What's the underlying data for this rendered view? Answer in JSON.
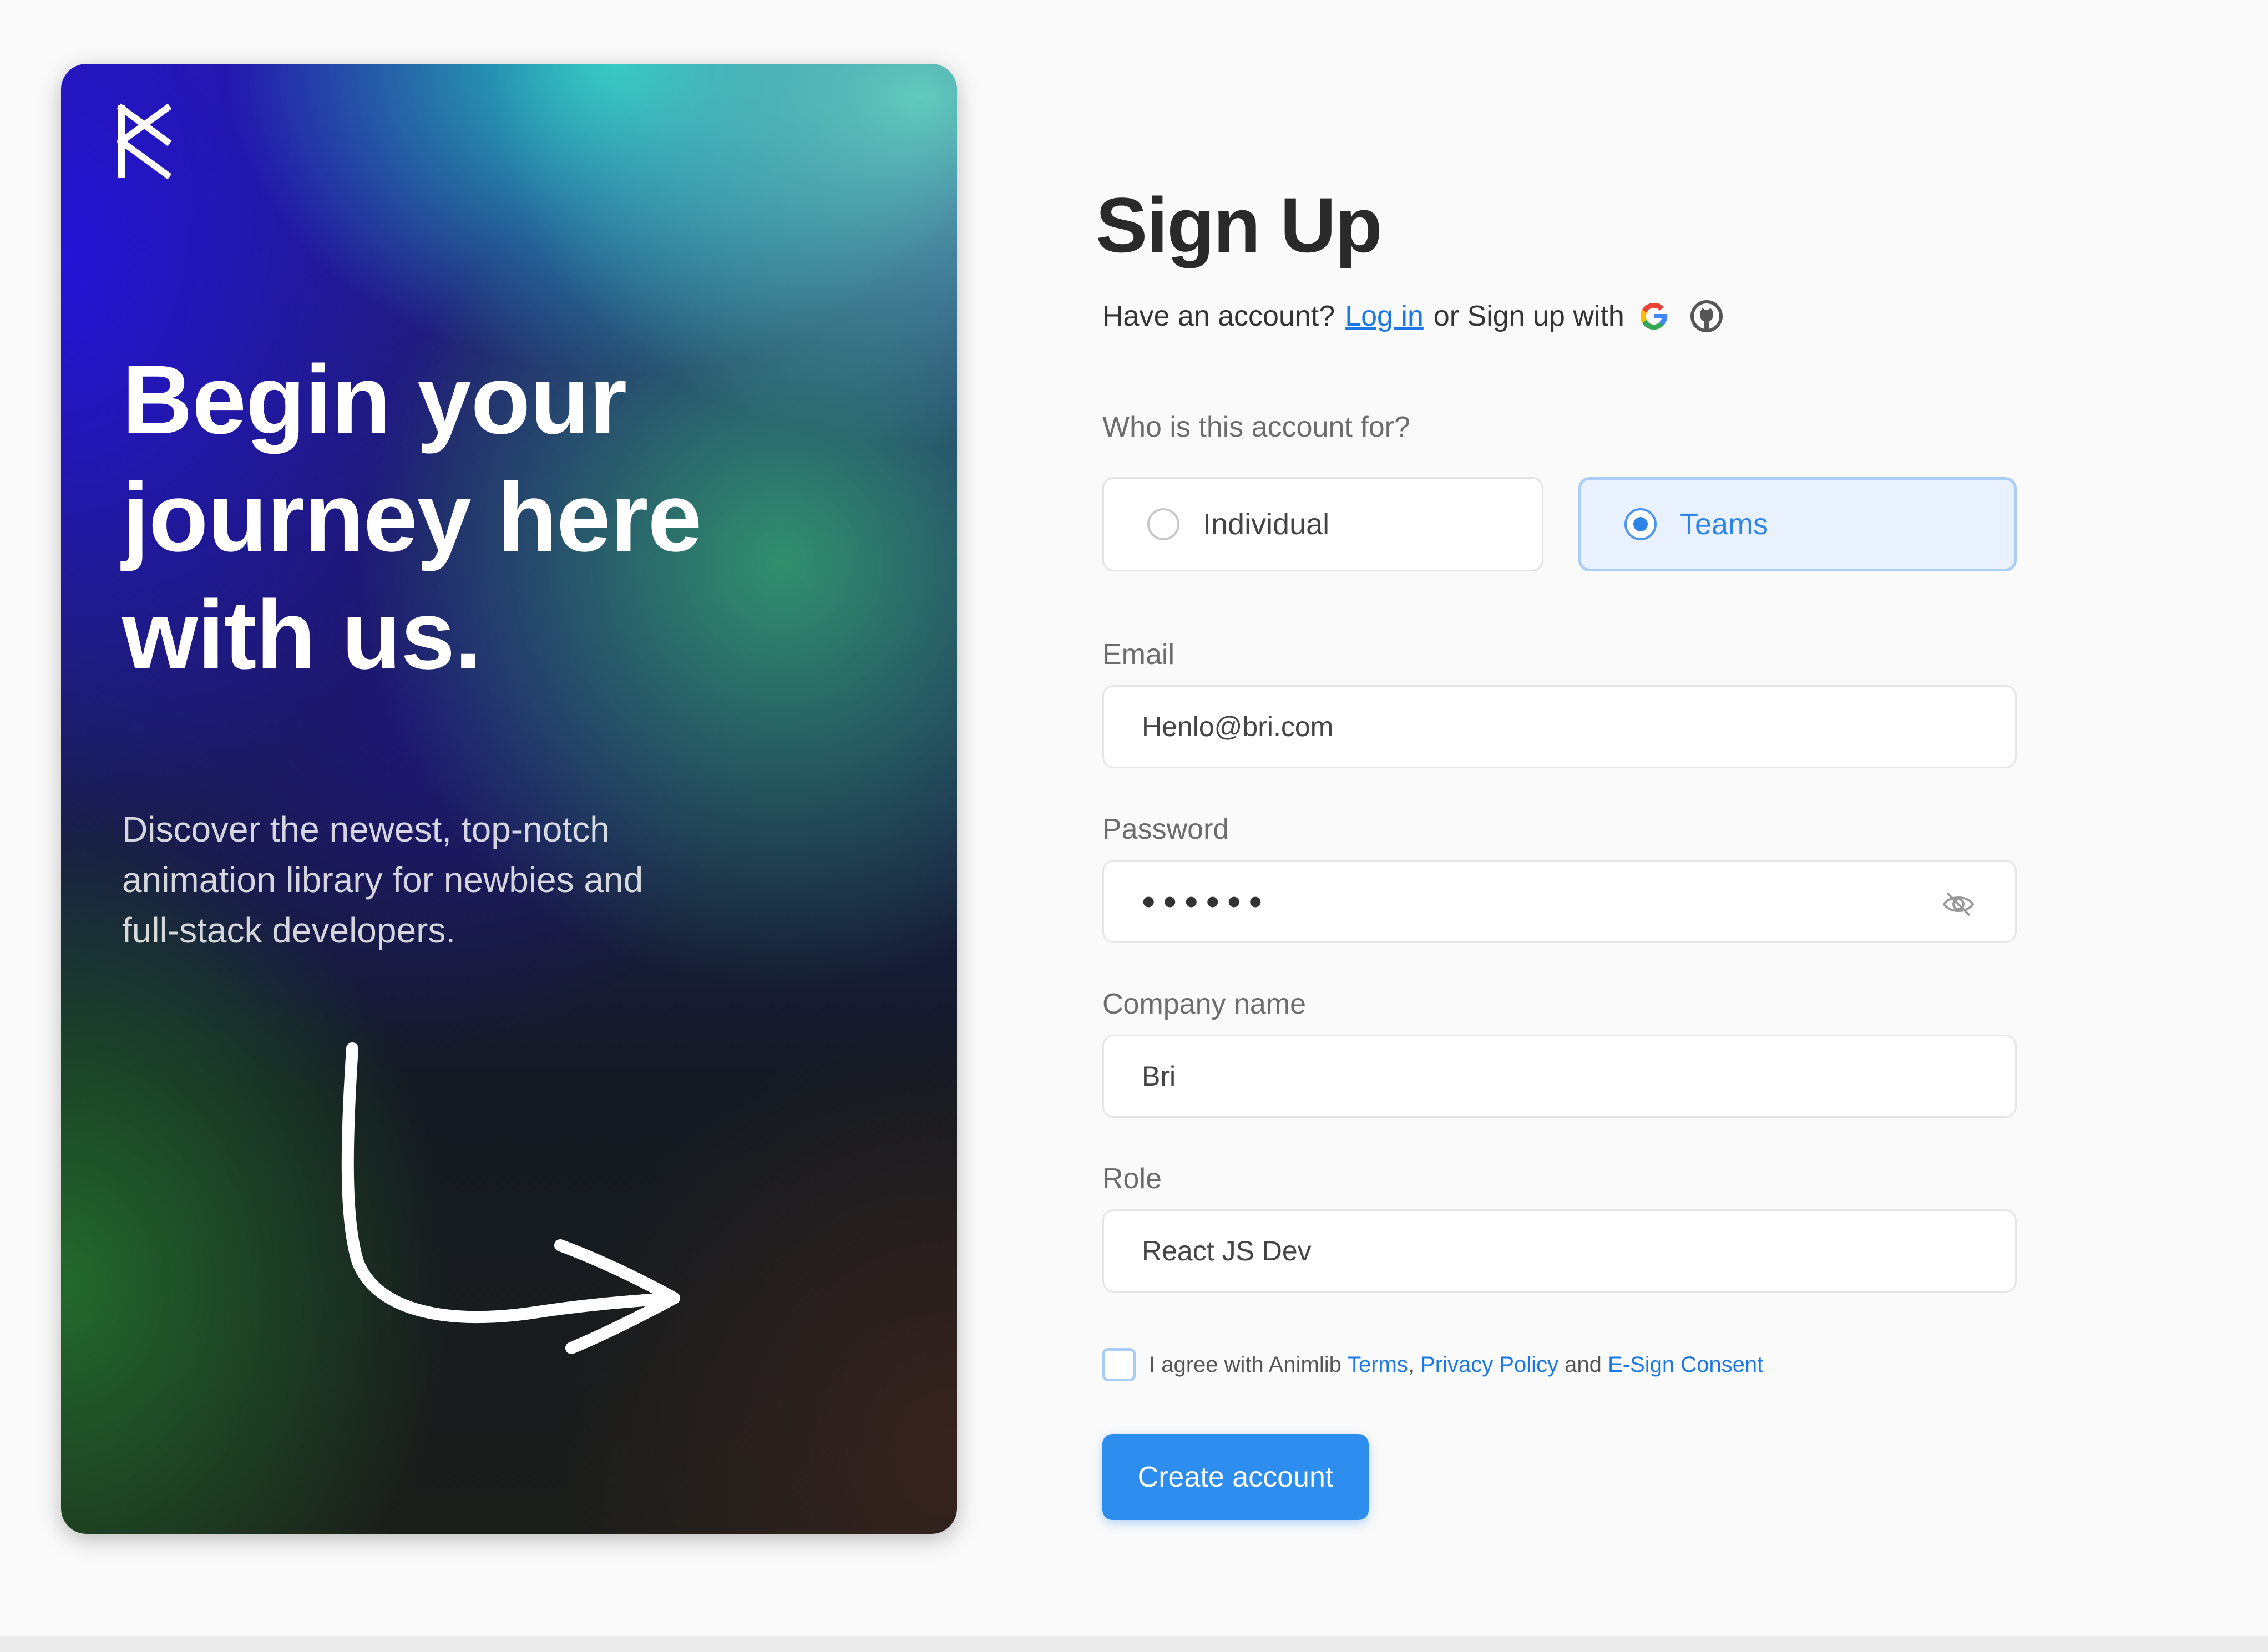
{
  "hero": {
    "logo_icon": "brand-logo-icon",
    "title_line1": "Begin your",
    "title_line2": "journey here",
    "title_line3": "with us.",
    "subtitle_line1": "Discover the newest, top-notch",
    "subtitle_line2": "animation library for newbies and",
    "subtitle_line3": "full-stack developers.",
    "arrow_icon": "curved-arrow-icon"
  },
  "form": {
    "title": "Sign Up",
    "have_account": "Have an account?",
    "login_link": "Log in",
    "or_signup": "or Sign up with",
    "social_icons": [
      "google-icon",
      "github-icon"
    ],
    "account_for_label": "Who is this account for?",
    "account_options": [
      "Individual",
      "Teams"
    ],
    "selected_option": "Teams",
    "email_label": "Email",
    "email_value": "Henlo@bri.com",
    "password_label": "Password",
    "password_value": "••••••",
    "company_label": "Company name",
    "company_value": "Bri",
    "role_label": "Role",
    "role_value": "React JS Dev",
    "agree_prefix": "I agree with Animlib",
    "terms_link": "Terms",
    "privacy_link": "Privacy Policy",
    "agree_and": "and",
    "esign_link": "E-Sign Consent",
    "create_button": "Create account"
  },
  "colors": {
    "accent": "#2e8ef0",
    "selected_card_bg": "#e8f1fd",
    "link": "#1a78e6"
  }
}
